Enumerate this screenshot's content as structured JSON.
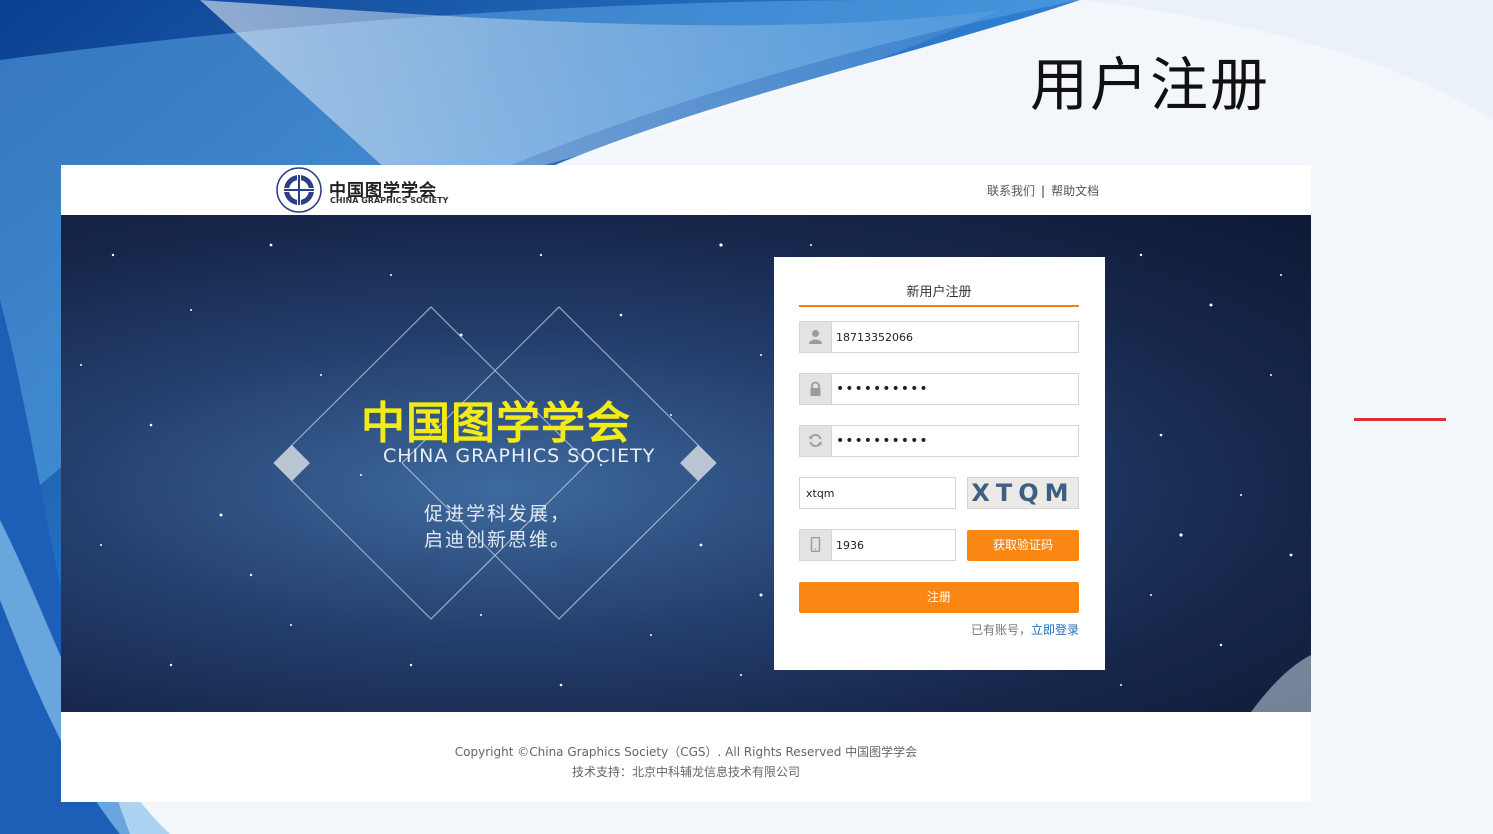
{
  "slide": {
    "title": "用户注册"
  },
  "header": {
    "logo_cn": "中国图学学会",
    "logo_en": "CHINA GRAPHICS SOCIETY",
    "links": [
      "联系我们",
      "帮助文档"
    ],
    "separator": "|"
  },
  "hero": {
    "title_cn": "中国图学学会",
    "title_en": "CHINA GRAPHICS SOCIETY",
    "slogan_line1": "促进学科发展，",
    "slogan_line2": "启迪创新思维。"
  },
  "form": {
    "title": "新用户注册",
    "username": {
      "value": "18713352066",
      "icon": "user-icon"
    },
    "password": {
      "value": "••••••••••",
      "icon": "lock-icon"
    },
    "confirm_password": {
      "value": "••••••••••",
      "icon": "refresh-icon"
    },
    "captcha_input": {
      "value": "xtqm"
    },
    "captcha_image_text": "XTQM",
    "sms_code": {
      "value": "1936",
      "icon": "phone-icon"
    },
    "get_code_label": "获取验证码",
    "register_label": "注册",
    "login_hint": "已有账号，",
    "login_link": "立即登录"
  },
  "footer": {
    "copyright": "Copyright ©China Graphics Society（CGS）. All Rights Reserved 中国图学学会",
    "support": "技术支持：北京中科辅龙信息技术有限公司"
  },
  "colors": {
    "accent": "#fa8713",
    "hero_title": "#f3ea16",
    "link": "#1e6fbf",
    "rule": "#d9312b"
  }
}
